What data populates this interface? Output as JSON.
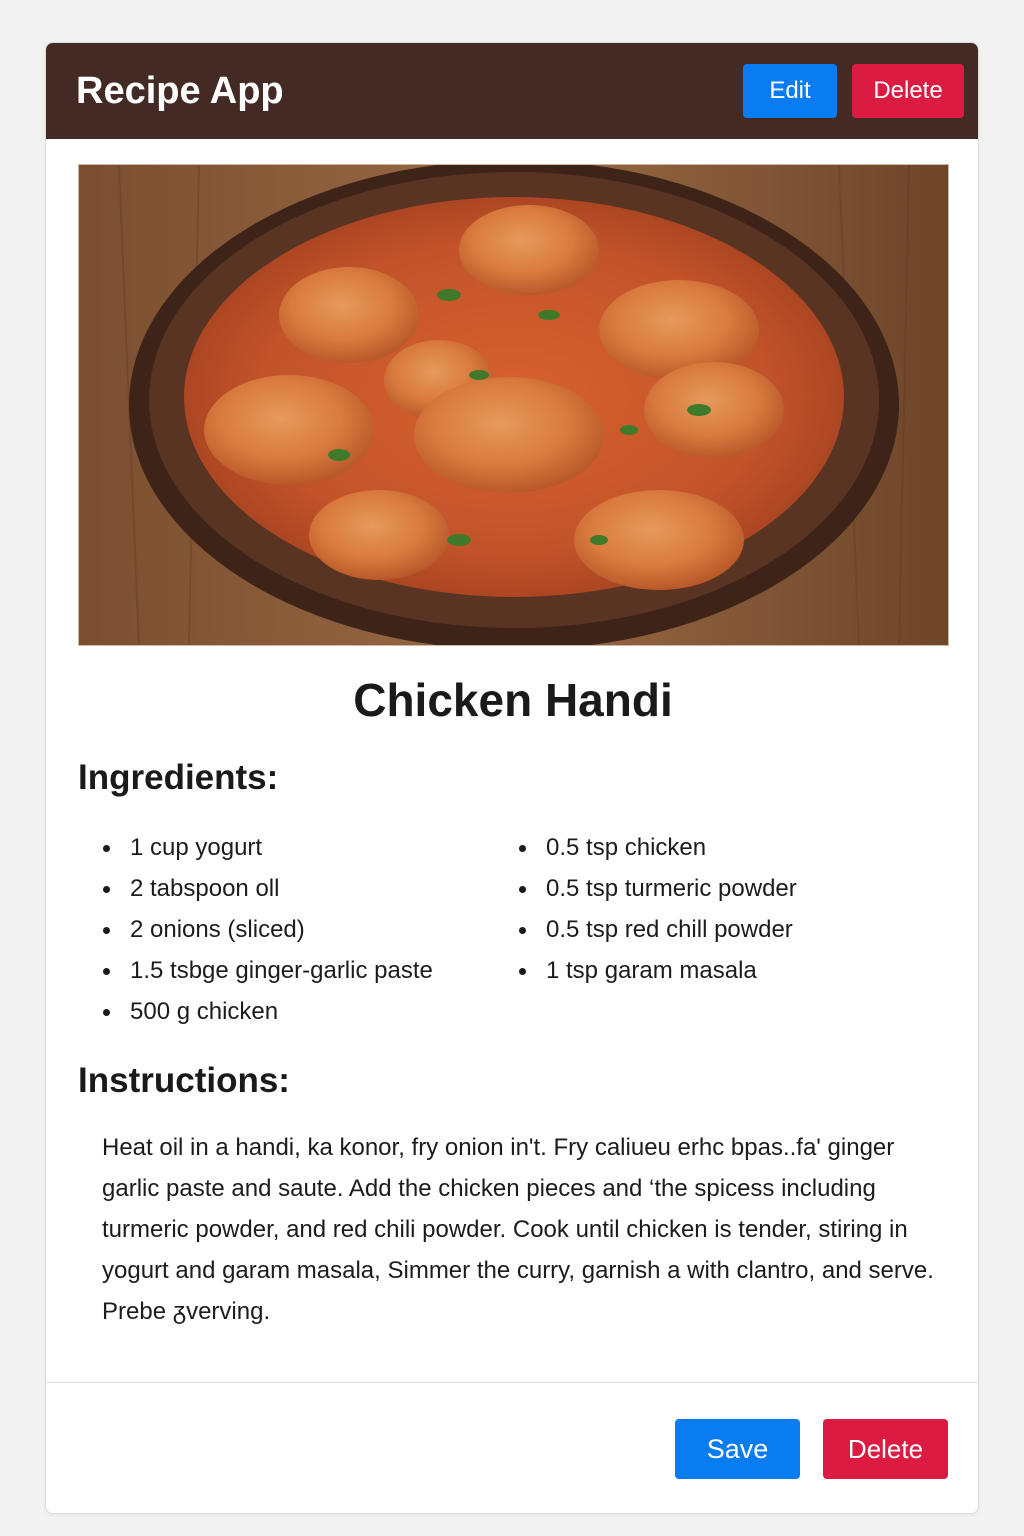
{
  "header": {
    "title": "Recipe App",
    "edit_label": "Edit",
    "delete_label": "Delete"
  },
  "recipe": {
    "title": "Chicken Handi",
    "ingredients_heading": "Ingredients:",
    "ingredients_left": [
      "1 cup yogurt",
      "2 tabspoon oll",
      "2 onions (sliced)",
      "1.5 tsbge ginger-garlic paste",
      "500 g chicken"
    ],
    "ingredients_right": [
      "0.5 tsp chicken",
      "0.5 tsp turmeric powder",
      "0.5 tsp red chill powder",
      "1 tsp garam masala"
    ],
    "instructions_heading": "Instructions:",
    "instructions_text": "Heat oil in a handi, ka konor, fry onion in't. Fry caliueu erhc bpas..fa' ginger garlic paste and saute. Add the chicken pieces and ‘the spicess including turmeric powder, and red chili powder. Cook until chicken is tender, stiring in yogurt and garam masala, Simmer the curry, garnish a with clantro, and serve. Prebe ᵹverving."
  },
  "footer": {
    "save_label": "Save",
    "delete_label": "Delete"
  },
  "colors": {
    "header_bg": "#442a24",
    "primary": "#0a7cf2",
    "danger": "#dc1b42"
  }
}
